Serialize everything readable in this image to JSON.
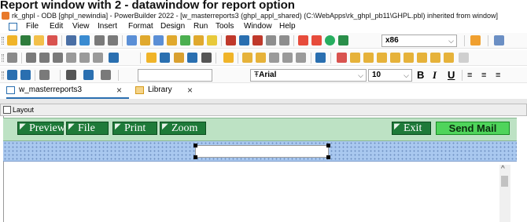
{
  "caption": "Report window with 2 - datawindow for report option",
  "window": {
    "title": "rk_ghpl - ODB [ghpl_newindia] - PowerBuilder 2022 - [w_masterreports3 (ghpl_appl_shared) (C:\\WebApps\\rk_ghpl_pb11\\GHPL.pbl) inherited from window]"
  },
  "menu": {
    "items": [
      "File",
      "Edit",
      "View",
      "Insert",
      "Format",
      "Design",
      "Run",
      "Tools",
      "Window",
      "Help"
    ]
  },
  "toolbar1": {
    "platform_value": "x86"
  },
  "toolbar3": {
    "font_value": "Arial",
    "font_prefix": "Ŧ",
    "size_value": "10",
    "bold": "B",
    "italic": "I",
    "underline": "U"
  },
  "tabs": [
    {
      "label": "w_masterreports3",
      "active": true
    },
    {
      "label": "Library",
      "active": false
    }
  ],
  "layout_panel": {
    "title": "Layout"
  },
  "dw_buttons": {
    "preview": "Preview",
    "file": "File",
    "print": "Print",
    "zoom": "Zoom",
    "exit": "Exit",
    "send_mail": "Send Mail"
  },
  "colors": {
    "button_green": "#1e7a39",
    "send_mail_green": "#4fd45b",
    "header_band": "#bde2c4",
    "grid_band": "#a9c8ef",
    "accent_blue": "#2a6fb0"
  }
}
